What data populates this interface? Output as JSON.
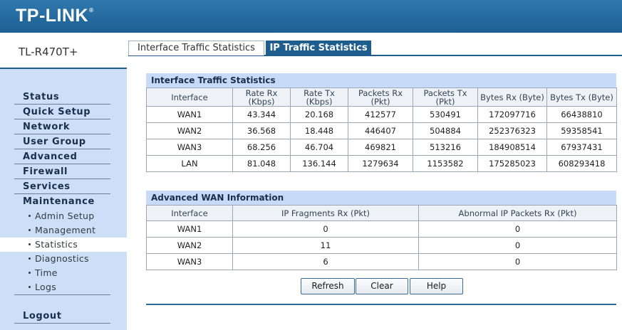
{
  "brand": {
    "logo_text": "TP-LINK",
    "model": "TL-R470T+"
  },
  "menu": {
    "items": [
      "Status",
      "Quick Setup",
      "Network",
      "User Group",
      "Advanced",
      "Firewall",
      "Services",
      "Maintenance"
    ],
    "maintenance_sub": [
      "Admin Setup",
      "Management",
      "Statistics",
      "Diagnostics",
      "Time",
      "Logs"
    ],
    "active_sub": "Statistics",
    "logout": "Logout"
  },
  "tabs": [
    "Interface Traffic Statistics",
    "IP Traffic Statistics"
  ],
  "active_tab": "IP Traffic Statistics",
  "traffic": {
    "title": "Interface Traffic Statistics",
    "headers": [
      [
        "Interface"
      ],
      [
        "Rate Rx",
        "(Kbps)"
      ],
      [
        "Rate Tx",
        "(Kbps)"
      ],
      [
        "Packets Rx",
        "(Pkt)"
      ],
      [
        "Packets Tx",
        "(Pkt)"
      ],
      [
        "Bytes Rx (Byte)"
      ],
      [
        "Bytes Tx (Byte)"
      ]
    ],
    "rows": [
      [
        "WAN1",
        "43.344",
        "20.168",
        "412577",
        "530491",
        "172097716",
        "66438810"
      ],
      [
        "WAN2",
        "36.568",
        "18.448",
        "446407",
        "504884",
        "252376323",
        "59358541"
      ],
      [
        "WAN3",
        "68.256",
        "46.704",
        "469821",
        "513216",
        "184908514",
        "67937431"
      ],
      [
        "LAN",
        "81.048",
        "136.144",
        "1279634",
        "1153582",
        "175285023",
        "608293418"
      ]
    ]
  },
  "wan_info": {
    "title": "Advanced WAN Information",
    "headers": [
      "Interface",
      "IP Fragments Rx (Pkt)",
      "Abnormal IP Packets Rx (Pkt)"
    ],
    "rows": [
      [
        "WAN1",
        "0",
        "0"
      ],
      [
        "WAN2",
        "11",
        "0"
      ],
      [
        "WAN3",
        "6",
        "0"
      ]
    ]
  },
  "buttons": {
    "refresh": "Refresh",
    "clear": "Clear",
    "help": "Help"
  },
  "colors": {
    "header_blue": "#1e5e8e",
    "sidebar": "#cddff7",
    "section_head": "#c7daf7"
  }
}
